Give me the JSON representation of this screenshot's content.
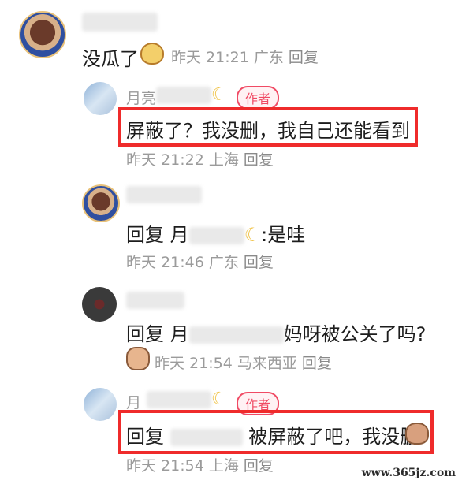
{
  "comments": [
    {
      "text": "没瓜了",
      "time": "昨天 21:21",
      "location": "广东",
      "reply": "回复"
    },
    {
      "name": "月亮",
      "badge": "作者",
      "text": "屏蔽了？我没删，我自己还能看到",
      "time": "昨天 21:22",
      "location": "上海",
      "reply": "回复"
    },
    {
      "prefix": "回复",
      "name": "月",
      "text": ":是哇",
      "time": "昨天 21:46",
      "location": "广东",
      "reply": "回复"
    },
    {
      "prefix": "回复",
      "name": "月",
      "text": "妈呀被公关了吗?",
      "time": "昨天 21:54",
      "location": "马来西亚",
      "reply": "回复"
    },
    {
      "name": "月",
      "badge": "作者",
      "prefix": "回复",
      "text": "被屏蔽了吧，我没删",
      "time": "昨天 21:54",
      "location": "上海",
      "reply": "回复"
    }
  ],
  "watermark": "www.365jz.com"
}
